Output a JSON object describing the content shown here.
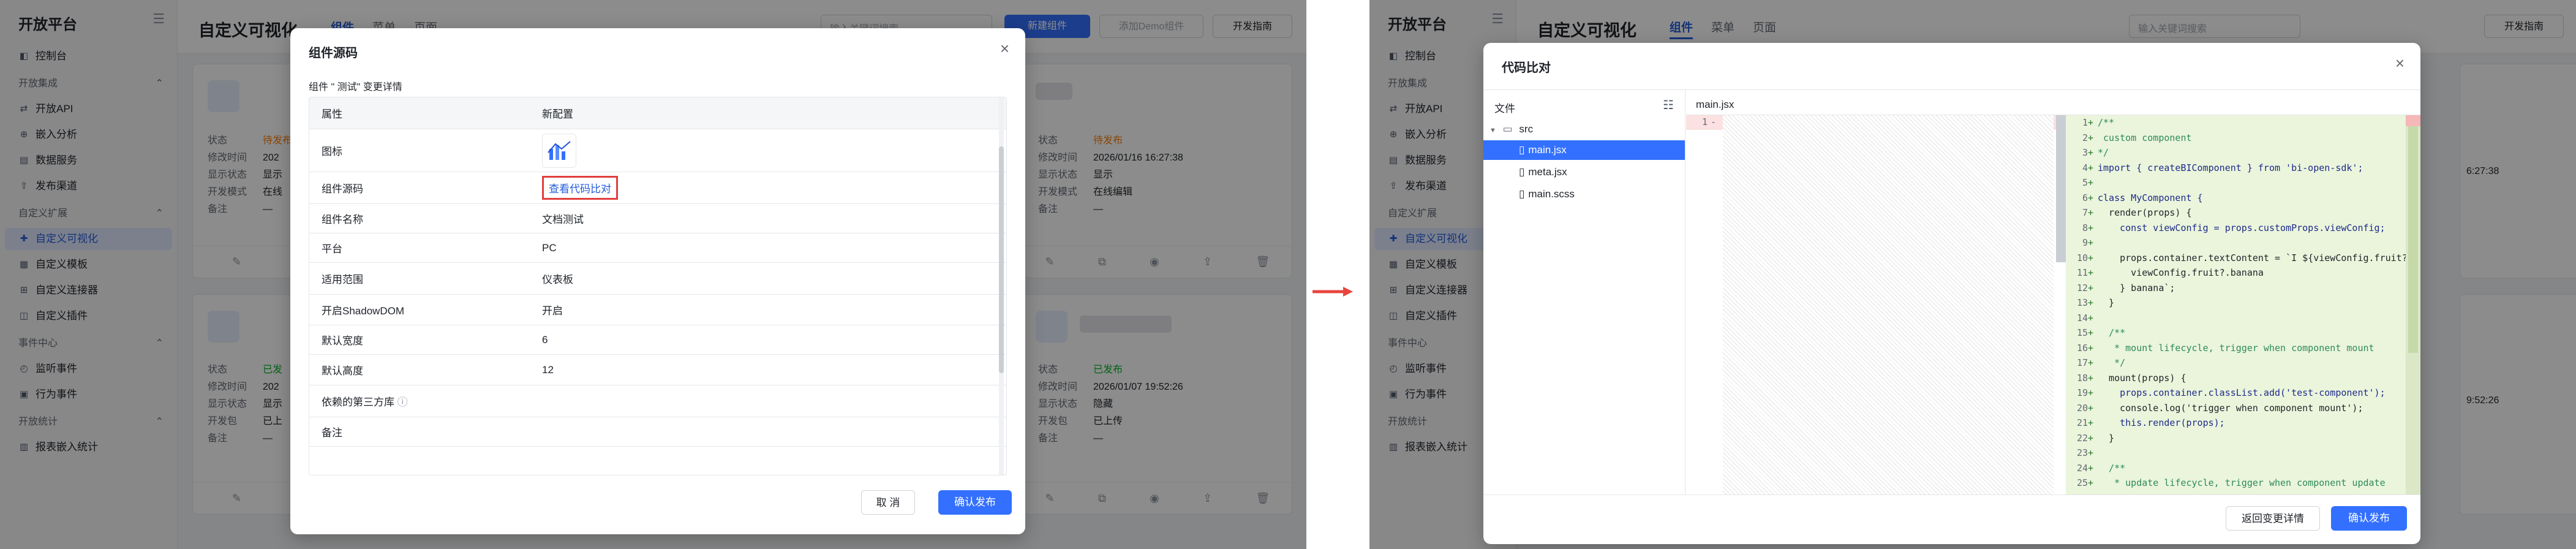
{
  "sidebar": {
    "title": "开放平台",
    "items_top": [
      {
        "icon": "dashboard-icon",
        "label": "控制台"
      }
    ],
    "group1": "开放集成",
    "items_g1": [
      {
        "icon": "api-icon",
        "label": "开放API"
      },
      {
        "icon": "embed-icon",
        "label": "嵌入分析"
      },
      {
        "icon": "data-service-icon",
        "label": "数据服务"
      },
      {
        "icon": "publish-channel-icon",
        "label": "发布渠道"
      }
    ],
    "group2": "自定义扩展",
    "items_g2": [
      {
        "icon": "puzzle-icon",
        "label": "自定义可视化"
      },
      {
        "icon": "template-icon",
        "label": "自定义模板"
      },
      {
        "icon": "connector-icon",
        "label": "自定义连接器"
      },
      {
        "icon": "plugin-icon",
        "label": "自定义插件"
      }
    ],
    "group3": "事件中心",
    "items_g3": [
      {
        "icon": "listen-icon",
        "label": "监听事件"
      },
      {
        "icon": "action-icon",
        "label": "行为事件"
      }
    ],
    "group4": "开放统计",
    "items_g4": [
      {
        "icon": "report-icon",
        "label": "报表嵌入统计"
      }
    ]
  },
  "header": {
    "title": "自定义可视化",
    "tabs": [
      "组件",
      "菜单",
      "页面"
    ],
    "search_placeholder": "输入关键词搜索",
    "create_button": "新建组件",
    "demo_button": "添加Demo组件",
    "guide_button": "开发指南"
  },
  "cards": {
    "labels": {
      "status": "状态",
      "modified": "修改时间",
      "display": "显示状态",
      "dev_mode": "开发模式",
      "note": "备注",
      "package": "开发包"
    },
    "left_status_pending": "待发布",
    "left_year": "202",
    "left_display": "显示",
    "left_dev": "在线",
    "left_status_pub": "已发",
    "left_pkg": "已上",
    "dash": "—",
    "right_top_status": "待发布",
    "right_top_time": "2026/01/16 16:27:38",
    "right_top_display": "显示",
    "right_top_dev": "在线编辑",
    "right_bot_status": "已发布",
    "right_bot_time": "2026/01/07 19:52:26",
    "right_bot_display": "隐藏",
    "right_bot_pkg": "已上传",
    "right_time_partial_1": "6:27:38",
    "right_time_partial_2": "9:52:26"
  },
  "modal1": {
    "title": "组件源码",
    "subtitle": "组件 \"      测试\" 变更详情",
    "col_attr": "属性",
    "col_new": "新配置",
    "rows": [
      {
        "k": "图标",
        "v": ""
      },
      {
        "k": "组件源码",
        "v": "查看代码比对"
      },
      {
        "k": "组件名称",
        "v": "文档测试"
      },
      {
        "k": "平台",
        "v": "PC"
      },
      {
        "k": "适用范围",
        "v": "仪表板"
      },
      {
        "k": "开启ShadowDOM",
        "v": "开启"
      },
      {
        "k": "默认宽度",
        "v": "6"
      },
      {
        "k": "默认高度",
        "v": "12"
      },
      {
        "k": "依赖的第三方库",
        "v": ""
      },
      {
        "k": "备注",
        "v": ""
      }
    ],
    "cancel": "取 消",
    "confirm": "确认发布"
  },
  "modal2": {
    "title": "代码比对",
    "files_label": "文件",
    "folder": "src",
    "files": [
      "main.jsx",
      "meta.jsx",
      "main.scss"
    ],
    "open_file": "main.jsx",
    "left_line": "1",
    "code": [
      "/**",
      " custom component",
      "*/",
      "import { createBIComponent } from 'bi-open-sdk';",
      "",
      "class MyComponent {",
      "  render(props) {",
      "    const viewConfig = props.customProps.viewConfig;",
      "",
      "    props.container.textContent = `I ${viewConfig.fruit?.a",
      "      viewConfig.fruit?.banana",
      "    } banana`;",
      "  }",
      "",
      "  /**",
      "   * mount lifecycle, trigger when component mount",
      "   */",
      "  mount(props) {",
      "    props.container.classList.add('test-component');",
      "    console.log('trigger when component mount');",
      "    this.render(props);",
      "  }",
      "",
      "  /**",
      "   * update lifecycle, trigger when component update",
      "   */"
    ],
    "back": "返回变更详情",
    "confirm": "确认发布"
  },
  "colors": {
    "accent": "#3370ff",
    "added_bg": "#eaf5dc",
    "removed_bg": "#fbe1e1",
    "arrow": "#e8453c"
  }
}
